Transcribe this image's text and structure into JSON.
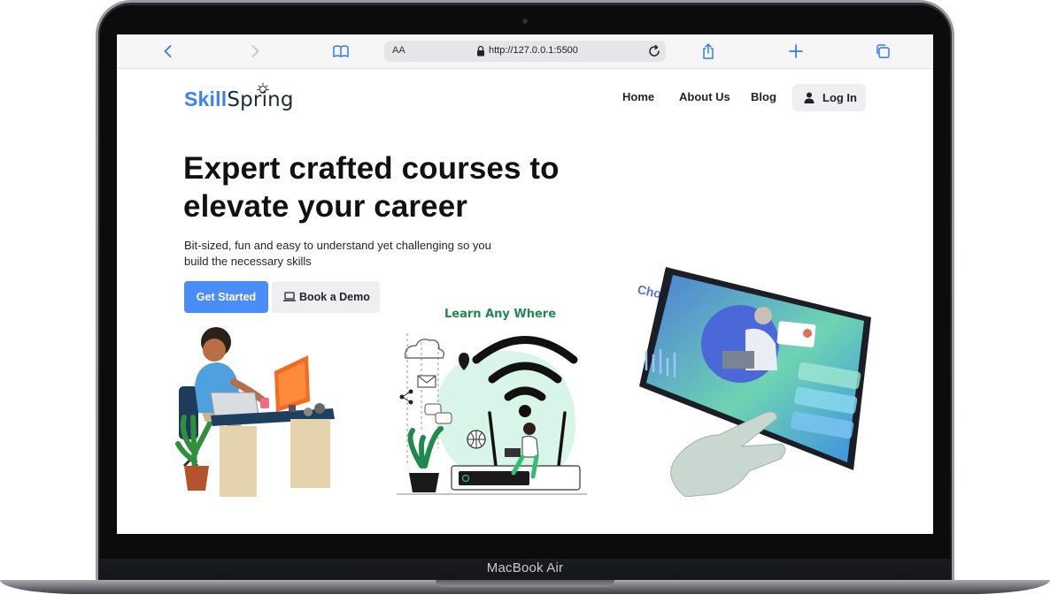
{
  "device": {
    "label": "MacBook Air"
  },
  "browser": {
    "text_size_label": "AA",
    "url": "http://127.0.0.1:5500"
  },
  "brand": {
    "part1": "Skill",
    "part2": "Spring",
    "accent_color": "#3b82f6"
  },
  "nav": {
    "items": [
      {
        "label": "Home"
      },
      {
        "label": "About Us"
      },
      {
        "label": "Blog"
      }
    ],
    "login_label": "Log In"
  },
  "hero": {
    "headline_line1": "Expert crafted courses to",
    "headline_line2": "elevate your career",
    "subtext_line1": "Bit-sized, fun and easy to understand yet challenging so you",
    "subtext_line2": "build the necessary skills",
    "primary_cta": "Get Started",
    "secondary_cta": "Book a Demo",
    "primary_color": "#4b8df8"
  },
  "illustrations": {
    "middle_title": "Learn Any Where",
    "right_title": "Choose yours"
  }
}
